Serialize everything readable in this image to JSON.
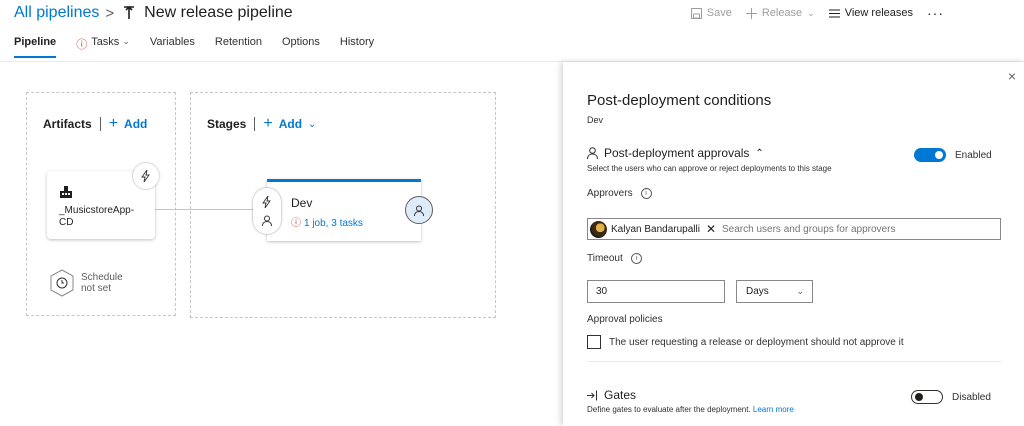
{
  "header": {
    "breadcrumb_root": "All pipelines",
    "separator": ">",
    "pipeline_title": "New release pipeline"
  },
  "toolbar": {
    "save_label": "Save",
    "release_label": "Release",
    "view_releases_label": "View releases",
    "more_label": "···"
  },
  "tabs": [
    {
      "label": "Pipeline"
    },
    {
      "label": "Tasks"
    },
    {
      "label": "Variables"
    },
    {
      "label": "Retention"
    },
    {
      "label": "Options"
    },
    {
      "label": "History"
    }
  ],
  "artifacts": {
    "heading": "Artifacts",
    "add_label": "Add",
    "artifact_name": "_MusicstoreApp-CD",
    "schedule_line1": "Schedule",
    "schedule_line2": "not set"
  },
  "stages": {
    "heading": "Stages",
    "add_label": "Add",
    "stage_name": "Dev",
    "stage_tasks": "1 job, 3 tasks"
  },
  "panel": {
    "close_label": "×",
    "title": "Post-deployment conditions",
    "subtitle": "Dev",
    "approvals": {
      "title": "Post-deployment approvals",
      "description": "Select the users who can approve or reject deployments to this stage",
      "toggle_label": "Enabled",
      "approvers_label": "Approvers",
      "approver_name": "Kalyan Bandarupalli",
      "search_placeholder": "Search users and groups for approvers"
    },
    "timeout": {
      "label": "Timeout",
      "value": "30",
      "unit": "Days"
    },
    "policies": {
      "label": "Approval policies",
      "checkbox_label": "The user requesting a release or deployment should not approve it"
    },
    "gates": {
      "title": "Gates",
      "description": "Define gates to evaluate after the deployment.",
      "learn_more": "Learn more",
      "toggle_label": "Disabled"
    }
  },
  "colors": {
    "accent": "#0078d4",
    "warning": "#d13438"
  }
}
